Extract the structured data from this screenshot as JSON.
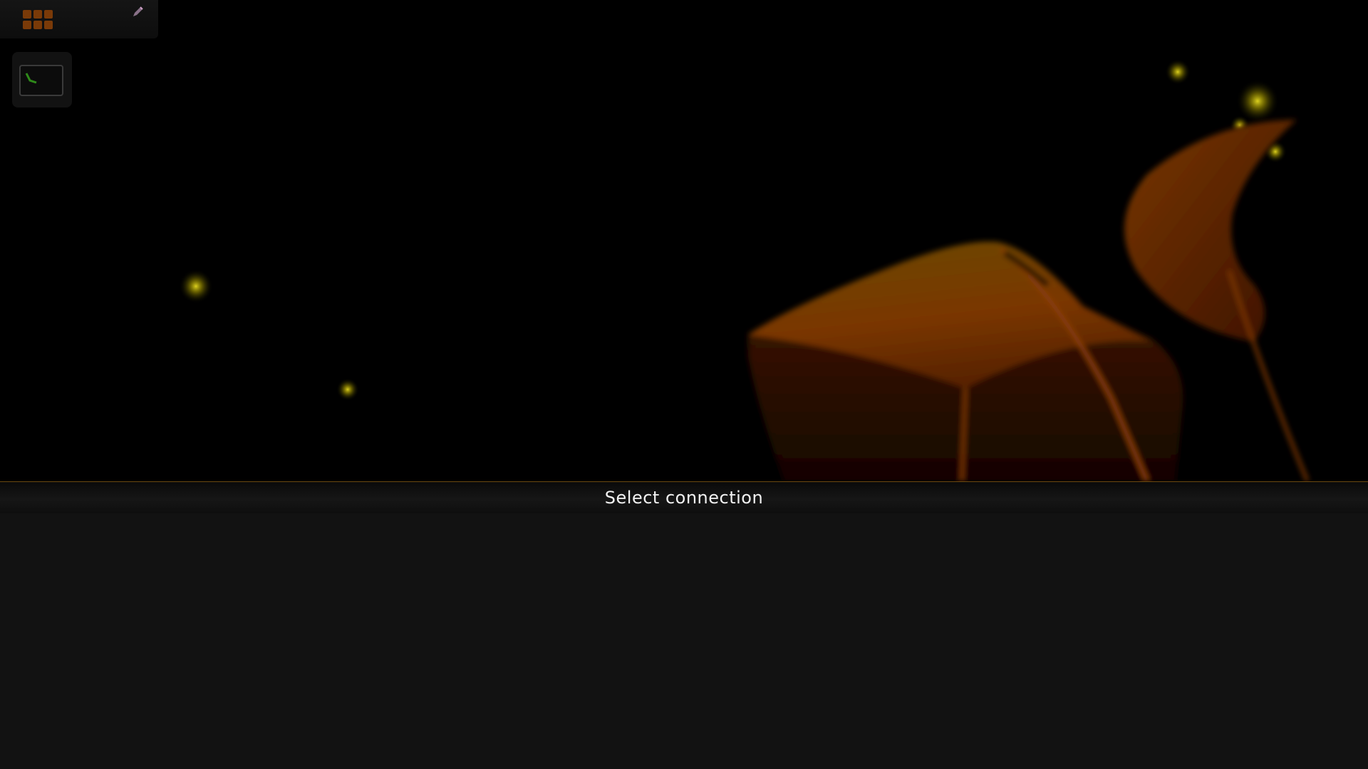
{
  "desktop": {
    "background_color": "#000000",
    "accent_color": "#c0580a",
    "glow_color": "#d8c800"
  },
  "top_panel": {
    "app_grid_icon": "apps-grid-icon",
    "edit_icon": "pencil-icon"
  },
  "launcher": {
    "terminal_icon": "terminal-icon"
  },
  "dialog": {
    "title": "Select connection",
    "header_border_color": "#6b4a10",
    "body_color": "#121212"
  }
}
